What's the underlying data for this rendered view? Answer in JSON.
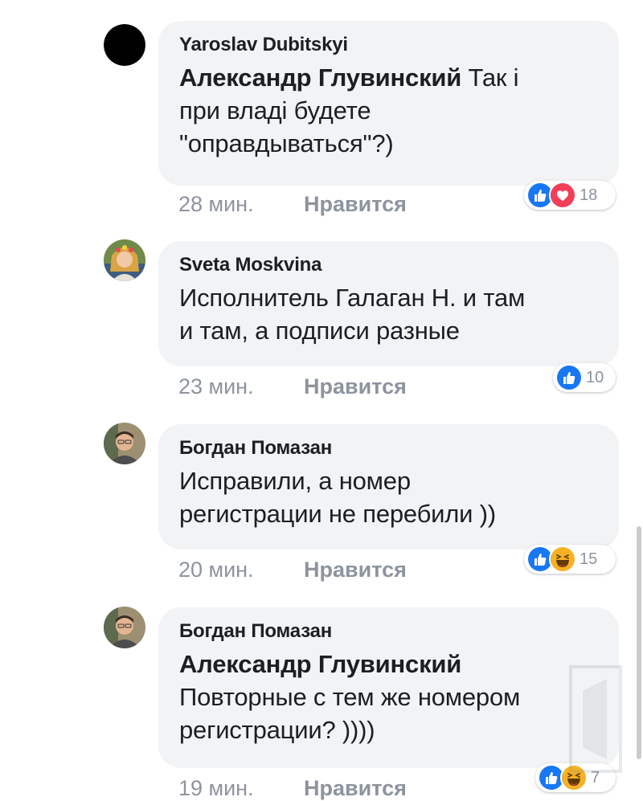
{
  "comments": [
    {
      "author": "Yaroslav Dubitskyi",
      "mention": "Александр Глувинский",
      "text_lines_first": " Так і",
      "text_lines": [
        "при владі будете",
        "\"оправдываться\"?)"
      ],
      "time": "28 мин.",
      "like_label": "Нравится",
      "reactions": [
        "like-icon",
        "love-icon"
      ],
      "reaction_count": "18",
      "avatar": "black-circle-avatar"
    },
    {
      "author": "Sveta Moskvina",
      "text_lines": [
        "Исполнитель Галаган Н. и там",
        "и там, а подписи разные"
      ],
      "time": "23 мин.",
      "like_label": "Нравится",
      "reactions": [
        "like-icon"
      ],
      "reaction_count": "10",
      "avatar": "woman-photo-avatar"
    },
    {
      "author": "Богдан Помазан",
      "text_lines": [
        "Исправили, а номер",
        "регистрации не перебили ))"
      ],
      "time": "20 мин.",
      "like_label": "Нравится",
      "reactions": [
        "like-icon",
        "haha-icon"
      ],
      "reaction_count": "15",
      "avatar": "man-photo-avatar"
    },
    {
      "author": "Богдан Помазан",
      "mention": "Александр Глувинский",
      "text_lines": [
        "Повторные с тем же номером",
        "регистрации? ))))"
      ],
      "time": "19 мин.",
      "like_label": "Нравится",
      "reactions": [
        "like-icon",
        "haha-icon"
      ],
      "reaction_count": "7",
      "avatar": "man-photo-avatar"
    }
  ],
  "colors": {
    "bubble": "#f2f3f5",
    "like_blue": "#1877f2",
    "love_red": "#f33e58",
    "haha_yellow": "#f7b125",
    "meta_gray": "#8d949e"
  }
}
